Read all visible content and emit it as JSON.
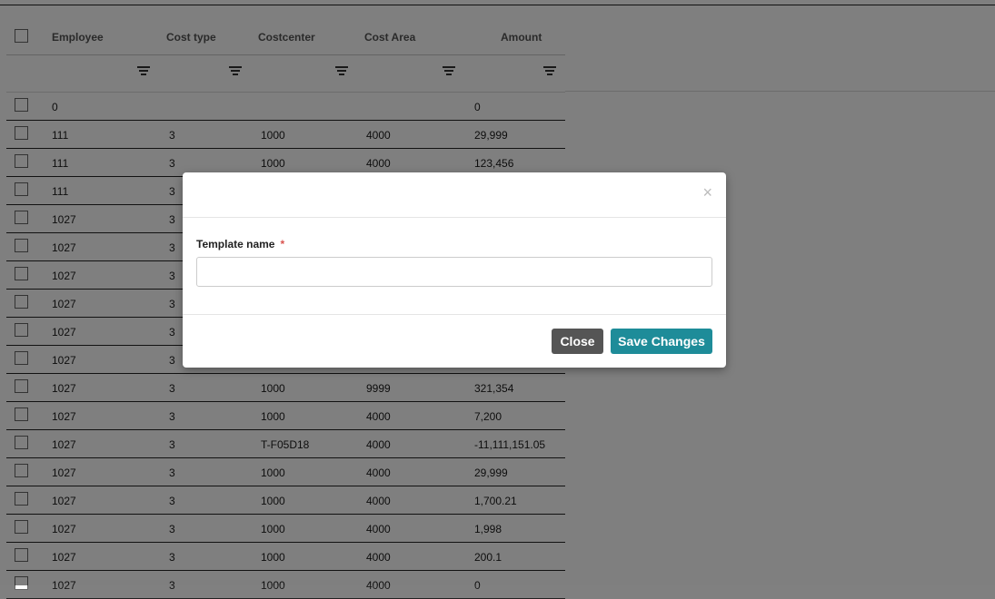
{
  "table": {
    "columns": [
      "Employee",
      "Cost type",
      "Costcenter",
      "Cost Area",
      "Amount"
    ],
    "rows": [
      {
        "employee": "0",
        "cost_type": "",
        "costcenter": "",
        "cost_area": "",
        "amount": "0"
      },
      {
        "employee": "111",
        "cost_type": "3",
        "costcenter": "1000",
        "cost_area": "4000",
        "amount": "29,999"
      },
      {
        "employee": "111",
        "cost_type": "3",
        "costcenter": "1000",
        "cost_area": "4000",
        "amount": "123,456"
      },
      {
        "employee": "111",
        "cost_type": "3",
        "costcenter": "",
        "cost_area": "",
        "amount": ""
      },
      {
        "employee": "1027",
        "cost_type": "3",
        "costcenter": "",
        "cost_area": "",
        "amount": ""
      },
      {
        "employee": "1027",
        "cost_type": "3",
        "costcenter": "",
        "cost_area": "",
        "amount": ""
      },
      {
        "employee": "1027",
        "cost_type": "3",
        "costcenter": "",
        "cost_area": "",
        "amount": ""
      },
      {
        "employee": "1027",
        "cost_type": "3",
        "costcenter": "",
        "cost_area": "",
        "amount": ""
      },
      {
        "employee": "1027",
        "cost_type": "3",
        "costcenter": "",
        "cost_area": "",
        "amount": ""
      },
      {
        "employee": "1027",
        "cost_type": "3",
        "costcenter": "",
        "cost_area": "",
        "amount": ""
      },
      {
        "employee": "1027",
        "cost_type": "3",
        "costcenter": "1000",
        "cost_area": "9999",
        "amount": "321,354"
      },
      {
        "employee": "1027",
        "cost_type": "3",
        "costcenter": "1000",
        "cost_area": "4000",
        "amount": "7,200"
      },
      {
        "employee": "1027",
        "cost_type": "3",
        "costcenter": "T-F05D18",
        "cost_area": "4000",
        "amount": "-11,111,151.05"
      },
      {
        "employee": "1027",
        "cost_type": "3",
        "costcenter": "1000",
        "cost_area": "4000",
        "amount": "29,999"
      },
      {
        "employee": "1027",
        "cost_type": "3",
        "costcenter": "1000",
        "cost_area": "4000",
        "amount": "1,700.21"
      },
      {
        "employee": "1027",
        "cost_type": "3",
        "costcenter": "1000",
        "cost_area": "4000",
        "amount": "1,998"
      },
      {
        "employee": "1027",
        "cost_type": "3",
        "costcenter": "1000",
        "cost_area": "4000",
        "amount": "200.1"
      },
      {
        "employee": "1027",
        "cost_type": "3",
        "costcenter": "1000",
        "cost_area": "4000",
        "amount": "0"
      }
    ]
  },
  "modal": {
    "close_glyph": "×",
    "field_label": "Template name",
    "required_mark": "*",
    "field_value": "",
    "close_label": "Close",
    "save_label": "Save Changes"
  },
  "colors": {
    "overlay": "#808080",
    "save_button": "#1e8c99",
    "close_button": "#555555",
    "required": "#d9534f"
  },
  "icons": {
    "filter": "filter-icon",
    "close": "close-icon",
    "checkbox": "checkbox"
  }
}
